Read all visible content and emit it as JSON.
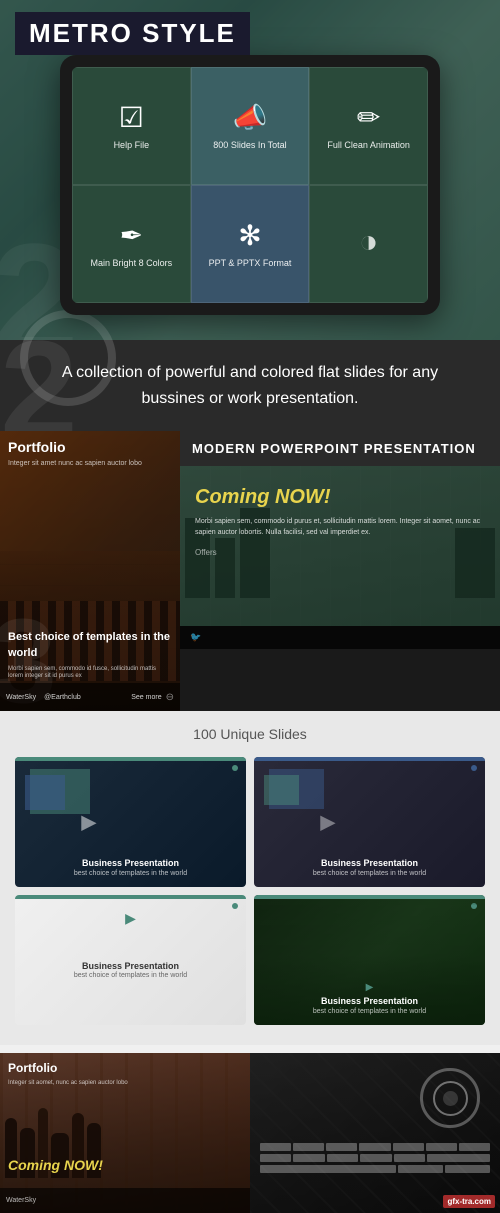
{
  "header": {
    "title": "METRO STYLE",
    "background_color": "#4a7c6f"
  },
  "tablet": {
    "cells": [
      {
        "icon": "✓",
        "label": "Help File"
      },
      {
        "icon": "📢",
        "label": "800 Slides In Total"
      },
      {
        "icon": "✏",
        "label": "Full Clean Animation"
      },
      {
        "icon": "✒",
        "label": "Main Bright 8 Colors"
      },
      {
        "icon": "✻",
        "label": "PPT & PPTX Format"
      },
      {
        "icon": "◑",
        "label": ""
      }
    ]
  },
  "description": {
    "text": "A collection of powerful and colored flat slides for any bussines or work presentation.",
    "number": "2"
  },
  "portfolio_left": {
    "label": "Portfolio",
    "body": "Integer sit amet nunc ac sapien auctor lobo",
    "overlay_text": "Best choice of templates in the world",
    "small_text": "Morbi sapien sem, commodo id fusce, sollicitudin mattis lorem integer sit id purus ex",
    "footer": "WaterSky",
    "footer2": "@Earthclub",
    "footer3": "See more"
  },
  "portfolio_right": {
    "title": "MODERN POWERPOINT PRESENTATION",
    "coming_now": "Coming NOW!",
    "coming_body": "Morbi sapien sem, commodo id purus et, sollicitudin mattis lorem. Integer sit aomet, nunc ac sapien auctor lobortis. Nulla facilisi, sed val imperdiet ex.",
    "offers": "Offers"
  },
  "unique_slides": {
    "title": "100 Unique Slides",
    "slides": [
      {
        "title": "Business Presentation",
        "subtitle": "best choice of templates in the world",
        "theme": "dark"
      },
      {
        "title": "Business Presentation",
        "subtitle": "best choice of templates in the world",
        "theme": "dark2"
      },
      {
        "title": "Business Presentation",
        "subtitle": "best choice of templates in the world",
        "theme": "light"
      },
      {
        "title": "Business Presentation",
        "subtitle": "best choice of templates in the world",
        "theme": "forest"
      }
    ]
  },
  "bottom": {
    "left_label": "Portfolio",
    "left_body": "Integer sit aomet, nunc ac sapien auctor lobo",
    "coming_now": "Coming NOW!",
    "watermark": "gfx-tra.com"
  }
}
